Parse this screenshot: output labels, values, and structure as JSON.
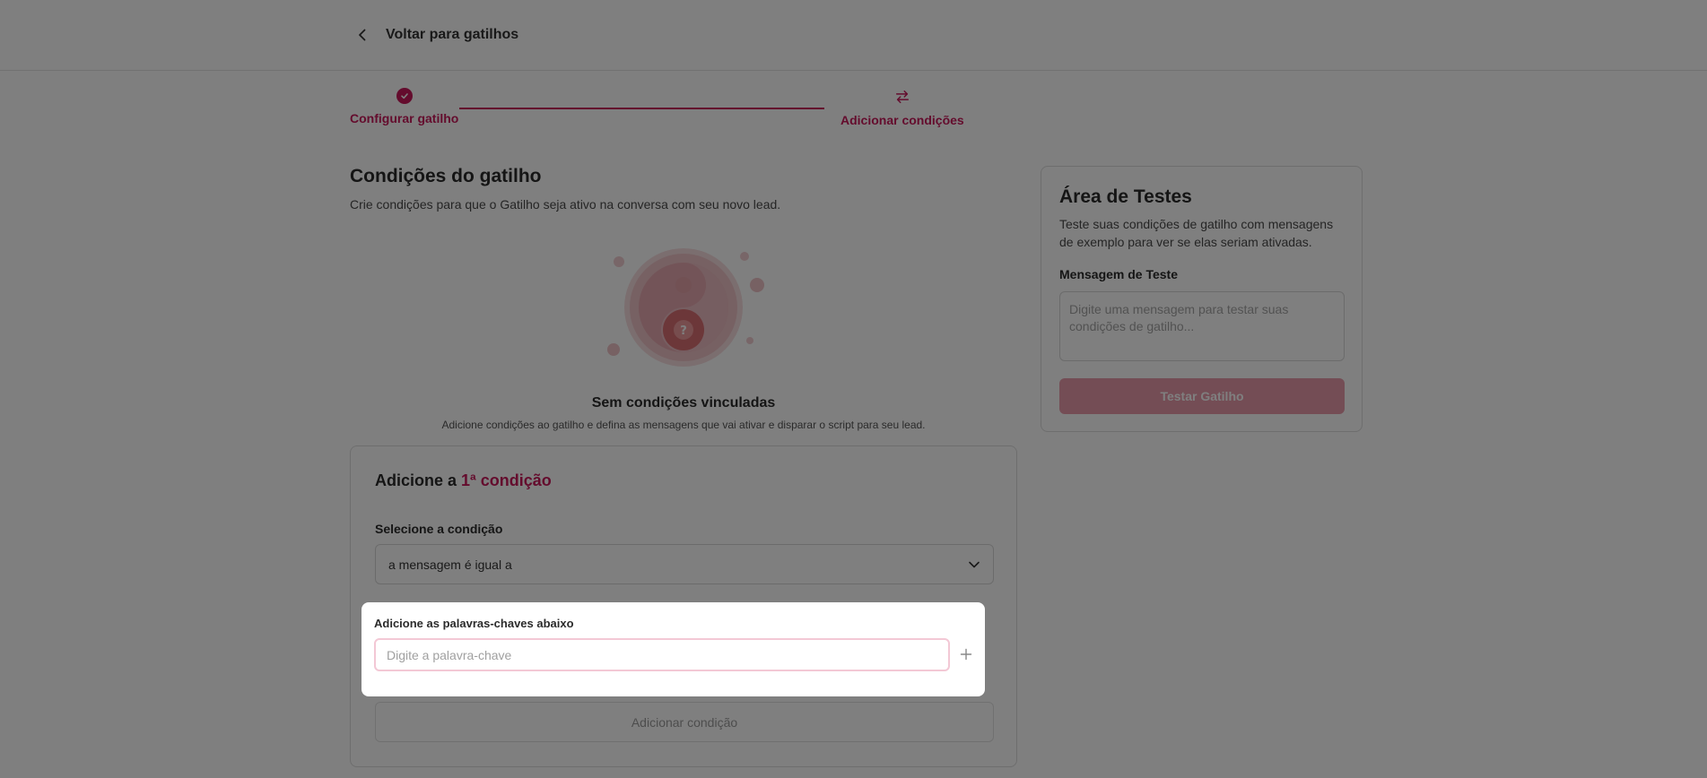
{
  "header": {
    "back_label": "Voltar para gatilhos"
  },
  "stepper": {
    "steps": [
      {
        "label": "Configurar gatilho",
        "status": "complete"
      },
      {
        "label": "Adicionar condições",
        "status": "current"
      }
    ]
  },
  "main": {
    "title": "Condições do gatilho",
    "subtitle": "Crie condições para que o Gatilho seja ativo na conversa com seu novo lead."
  },
  "empty_state": {
    "title": "Sem condições vinculadas",
    "description": "Adicione condições ao gatilho e defina as mensagens que vai ativar e disparar o script para seu lead.",
    "icon": "question-mark-icon"
  },
  "condition_card": {
    "title_prefix": "Adicione a ",
    "title_accent": "1ª condição",
    "select_label": "Selecione a condição",
    "select_value": "a mensagem é igual a",
    "add_button": "Adicionar condição"
  },
  "keyword_modal": {
    "label": "Adicione as palavras-chaves abaixo",
    "placeholder": "Digite a palavra-chave"
  },
  "test_area": {
    "title": "Área de Testes",
    "description": "Teste suas condições de gatilho com mensagens de exemplo para ver se elas seriam ativadas.",
    "field_label": "Mensagem de Teste",
    "placeholder": "Digite uma mensagem para testar suas condições de gatilho...",
    "button": "Testar Gatilho"
  },
  "colors": {
    "accent": "#c8185a",
    "button_disabled": "#e89aab",
    "overlay": "rgba(0,0,0,0.5)"
  }
}
